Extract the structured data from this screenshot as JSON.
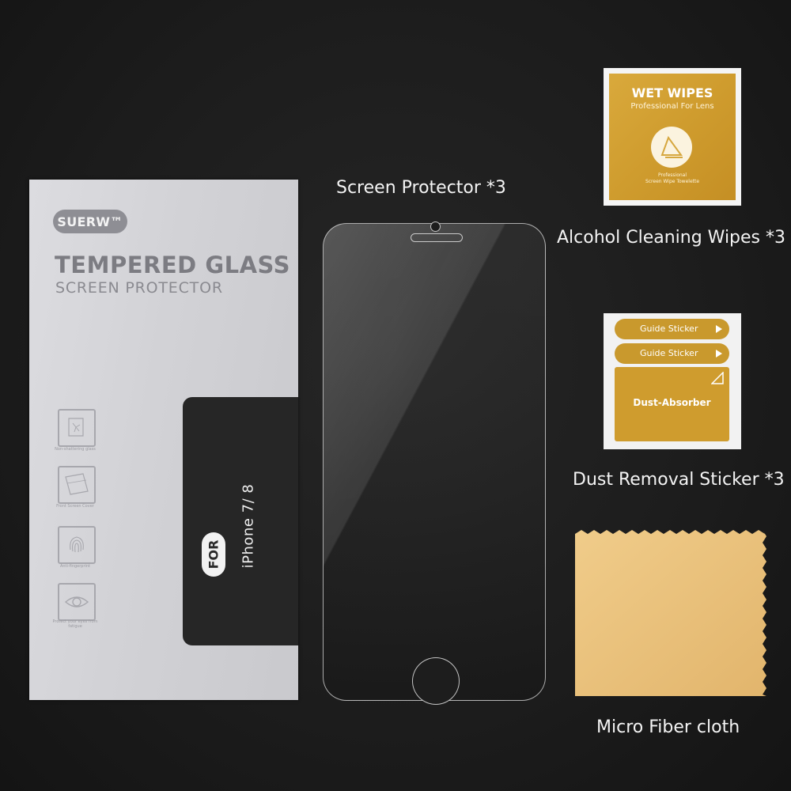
{
  "package": {
    "brand": "SUERW™",
    "title": "TEMPERED GLASS",
    "subtitle": "SCREEN PROTECTOR",
    "features": [
      {
        "icon": "shatter-glass-icon",
        "caption": "Non-shattering glass"
      },
      {
        "icon": "front-screen-icon",
        "caption": "Front Screen Cover"
      },
      {
        "icon": "fingerprint-icon",
        "caption": "Anti-fingerprint"
      },
      {
        "icon": "eye-icon",
        "caption": "Protect your eyes from fatigue"
      }
    ],
    "for_label": "FOR",
    "model": "iPhone 7/ 8"
  },
  "labels": {
    "screen_protector": "Screen Protector *3",
    "wipes": "Alcohol Cleaning Wipes *3",
    "dust_sticker": "Dust Removal Sticker *3",
    "cloth": "Micro Fiber cloth"
  },
  "wipes_packet": {
    "title": "WET WIPES",
    "subtitle": "Professional For Lens",
    "small_line1": "Professional",
    "small_line2": "Screen Wipe Towelette"
  },
  "dust_sticker": {
    "guide_1": "Guide Sticker",
    "guide_2": "Guide Sticker",
    "absorber": "Dust-Absorber"
  },
  "colors": {
    "background": "#1e1e1e",
    "package": "#d4d4d8",
    "gold": "#cf9c2e",
    "cloth": "#e8c07a"
  }
}
